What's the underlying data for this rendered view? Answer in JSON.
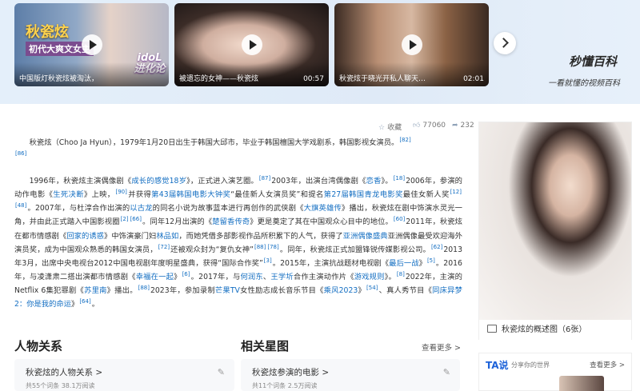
{
  "banner": {
    "videos": [
      {
        "caption": "中国版灯秋瓷炫被淘汰，",
        "overlay_title": "秋瓷炫",
        "overlay_subtitle": "初代大爽文女主",
        "overlay_logo": "idoL进化论",
        "duration": ""
      },
      {
        "caption": "被遗忘的女神——秋瓷炫",
        "duration": "00:57"
      },
      {
        "caption": "秋瓷炫于晓光开私人聊天…",
        "duration": "02:01"
      }
    ],
    "brand_logo": "秒懂百科",
    "brand_slogan": "一看就懂的视频百科"
  },
  "stats": {
    "favorite": "收藏",
    "likes": "77060",
    "shares": "232"
  },
  "article": {
    "p1": {
      "t1": "秋瓷炫（Choo Ja Hyun），1979年1月20日出生于韩国大邱市，毕业于韩国檀国大学戏剧系，韩国影视女演员。",
      "r1": "[82]",
      "r2": "[86]"
    },
    "p2": {
      "t1": "1996年，秋瓷炫主演偶像剧《",
      "l1": "成长的感觉18岁",
      "t2": "》，正式进入演艺圈。",
      "r1": "[87]",
      "t3": "2003年，出演台湾偶像剧《",
      "l2": "恋香",
      "t4": "》。",
      "r2": "[18]",
      "t5": "2006年，参演的动作电影《",
      "l3": "生死决断",
      "t6": "》上映，",
      "r3": "[90]",
      "t7": "并获得",
      "l4": "第43届韩国电影大钟奖",
      "t8": "“最佳新人女演员奖”和提名",
      "l5": "第27届韩国青龙电影奖",
      "t9": "最佳女新人奖",
      "r4": "[12]",
      "r5": "[48]",
      "t10": "。2007年，与杜淳合作出演的",
      "l6": "以古龙",
      "t11": "的同名小说为故事蓝本进行再创作的武侠剧《",
      "l7": "大旗英雄传",
      "t12": "》播出，秋瓷炫在剧中饰演水灵光一角，并由此正式踏入中国影视圈",
      "r6": "[2]",
      "r7": "[66]",
      "t13": "。同年12月出演的《",
      "l8": "楚留香传奇",
      "t14": "》更是奠定了其在中国观众心目中的地位。",
      "r8": "[60]",
      "t15": "2011年，秋瓷炫在都市情感剧《",
      "l9": "回家的诱惑",
      "t16": "》中饰演豪门妇",
      "l10": "林品如",
      "t17": "，而她凭借多部影视作品所积累下的人气，获得了",
      "l11": "亚洲偶像盛典",
      "t18": "亚洲偶像最受欢迎海外演员奖，成为中国观众熟悉的韩国女演员，",
      "r9": "[72]",
      "t19": "还被观众封为“复仇女神”",
      "r10": "[88]",
      "r11": "[78]",
      "t20": "。同年，秋瓷炫正式加盟锋锐传媒影视公司。",
      "r12": "[62]",
      "t21": "2013年3月，出席中央电视台2012中国电视剧年度明星盛典，获得“国际合作奖”",
      "r13": "[3]",
      "t22": "。2015年，主演抗战题材电视剧《",
      "l12": "最后一战",
      "t23": "》",
      "r14": "[5]",
      "t24": "。2016年，与凌潇肃二搭出演都市情感剧《",
      "l13": "幸福在一起",
      "t25": "》",
      "r15": "[6]",
      "t26": "。2017年，与",
      "l14": "何润东",
      "t27": "、",
      "l15": "王学圻",
      "t28": "合作主演动作片《",
      "l16": "游戏规则",
      "t29": "》。",
      "r16": "[8]",
      "t30": "2022年，主演的Netflix 6集犯罪剧《",
      "l17": "苏里南",
      "t31": "》播出。",
      "r17": "[88]",
      "t32": "2023年，参加录制",
      "l18": "芒果TV",
      "t33": "女性励志成长音乐节目《",
      "l19": "乘风2023",
      "t34": "》",
      "r18": "[54]",
      "t35": "、真人秀节目《",
      "l20": "同床异梦2：你是我的命运",
      "t36": "》",
      "r19": "[64]",
      "t37": "。"
    }
  },
  "sections": {
    "relations_title": "人物关系",
    "stars_title": "相关星图",
    "more": "查看更多 >",
    "relations_card": {
      "title": "秋瓷炫的人物关系 >",
      "meta": "共55个词条    38.1万阅读"
    },
    "stars_card": {
      "title": "秋瓷炫参演的电影 >",
      "meta": "共11个词条    2.5万阅读"
    }
  },
  "sidebar": {
    "profile_caption": "秋瓷炫的概述图（6张）",
    "ta_logo": "TA说",
    "ta_slogan": "分享你的世界",
    "ta_more": "查看更多 >"
  },
  "colors": {
    "link": "#136ec2",
    "banner_bg": "#e4effa",
    "ta_blue": "#1d62d9"
  },
  "icons": [
    "play-icon",
    "chevron-right-icon",
    "star-icon",
    "thumbs-up-icon",
    "share-icon",
    "gallery-icon",
    "edit-icon"
  ]
}
